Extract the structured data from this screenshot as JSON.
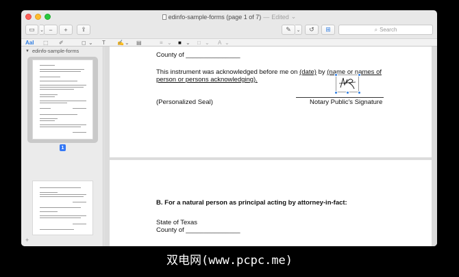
{
  "window": {
    "title": "edinfo-sample-forms (page 1 of 7)",
    "title_separator": "—",
    "edited_label": "Edited",
    "edited_chevron": "⌄"
  },
  "toolbar": {
    "search_placeholder": "Search",
    "sidebar_glyph": "▭",
    "zoom_out_glyph": "−",
    "zoom_in_glyph": "+",
    "share_glyph": "⇪",
    "markup_glyph": "✎",
    "rotate_glyph": "↺",
    "toolbox_glyph": "⊞",
    "search_glyph": "⌕",
    "chevron_glyph": "⌄"
  },
  "markup_toolbar": {
    "text_select_label": "AaI",
    "rect_select_glyph": "⬚",
    "sketch_glyph": "✐",
    "shapes_glyph": "◻",
    "text_box_glyph": "T",
    "sign_glyph": "✍",
    "note_glyph": "▤",
    "line_style_glyph": "≡",
    "border_color_glyph": "■",
    "fill_color_glyph": "□",
    "text_style_glyph": "A",
    "chevron_glyph": "⌄"
  },
  "sidebar": {
    "document_name": "edinfo-sample-forms",
    "disclosure_glyph": "▼",
    "current_page_badge": "1",
    "add_glyph": "+"
  },
  "document": {
    "page1": {
      "county_line": "County of _______________",
      "ack_line1_prefix": "This instrument was acknowledged before me on",
      "ack_date": "(date)",
      "ack_by": "by",
      "ack_names1": "(name or names of",
      "ack_names2": "person or persons acknowledging).",
      "seal_label": "(Personalized Seal)",
      "notary_label": "Notary Public's Signature"
    },
    "page2": {
      "heading": "B. For a natural person as principal acting by attorney-in-fact:",
      "state_line": "State of Texas",
      "county_line": "County of _______________"
    }
  },
  "caption": {
    "text": "双电网(www.pcpc.me)"
  },
  "colors": {
    "accent": "#2f7de1",
    "badge": "#3478f6",
    "window_bg": "#e8e8e8",
    "content_bg": "#dcdcdc"
  }
}
